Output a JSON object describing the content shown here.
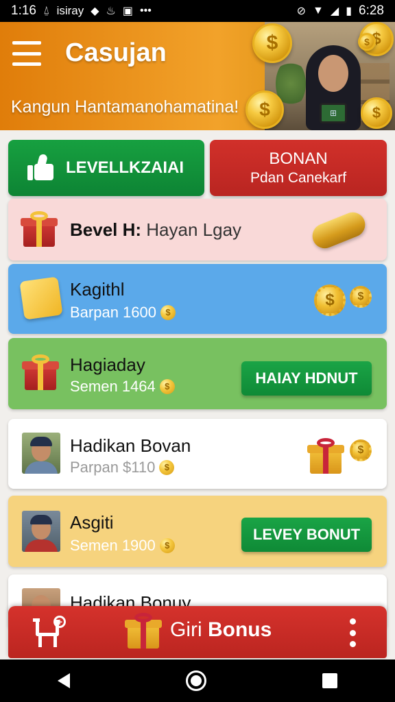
{
  "status_bar": {
    "time": "1:16",
    "app_label": "isiray",
    "clock": "6:28"
  },
  "header": {
    "title": "Casujan",
    "tagline": "Kangun Hantamanohamatina!",
    "coin_symbol": "$"
  },
  "actions": {
    "level_label": "LEVELLKZAIAI",
    "bonan_title": "BONAN",
    "bonan_sub": "Pdan Canekarf"
  },
  "list": [
    {
      "name_bold": "Bevel H:",
      "name_rest": " Hayan Lgay",
      "bg": "#f9d9d8"
    },
    {
      "name": "Kagithl",
      "sub": "Barpan 1600",
      "bg": "#5ba9ea"
    },
    {
      "name": "Hagiaday",
      "sub": "Semen 1464",
      "button": "HAIAY HDNUT",
      "bg": "#78c160"
    },
    {
      "name": "Hadikan Bovan",
      "sub": "Parpan $110",
      "bg": "#ffffff"
    },
    {
      "name": "Asgiti",
      "sub": "Semen 1900",
      "button": "LEVEY BONUT",
      "bg": "#f6d37e"
    },
    {
      "name": "Hadikan Bonuy",
      "bg": "#ffffff"
    }
  ],
  "bonus_bar": {
    "label_light": "Giri",
    "label_bold": " Bonus"
  },
  "colors": {
    "header_orange": "#f2a22a",
    "green_button": "#0f8a36",
    "red_button": "#bb2520"
  }
}
